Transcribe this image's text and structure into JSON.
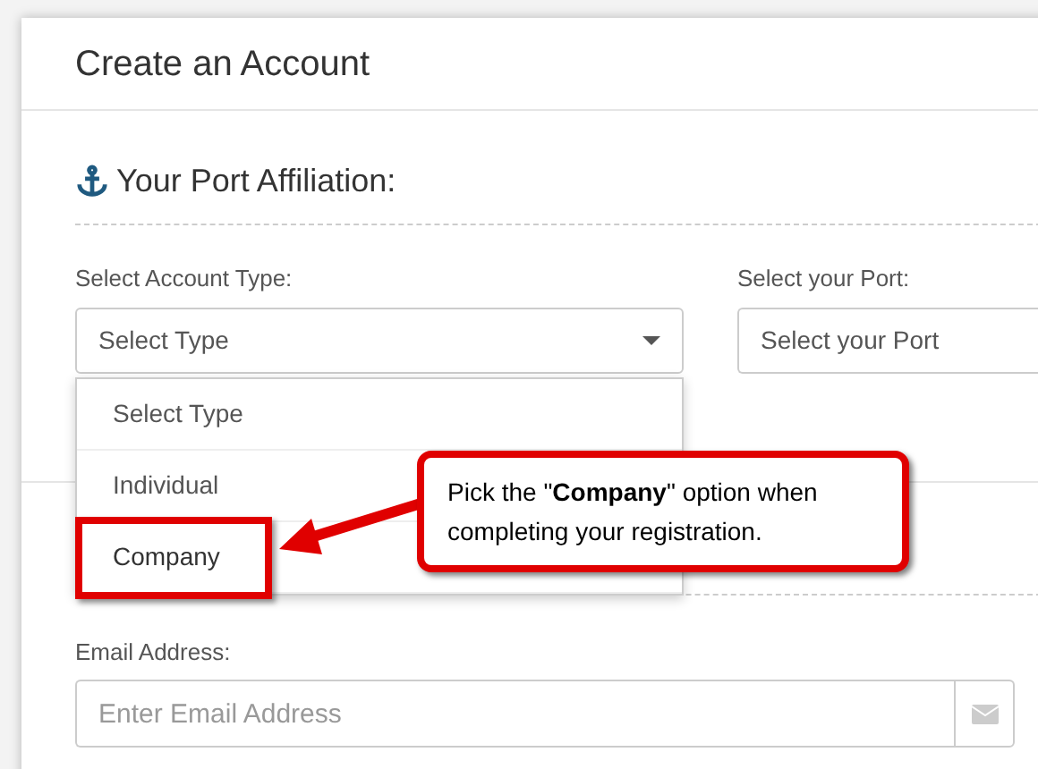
{
  "card": {
    "title": "Create an Account"
  },
  "section": {
    "title": "Your Port Affiliation:"
  },
  "account_type": {
    "label": "Select Account Type:",
    "value": "Select Type",
    "options": [
      {
        "label": "Select Type",
        "highlighted": false
      },
      {
        "label": "Individual",
        "highlighted": false
      },
      {
        "label": "Company",
        "highlighted": true
      }
    ]
  },
  "port": {
    "label": "Select your Port:",
    "value": "Select your Port"
  },
  "email": {
    "label": "Email Address:",
    "placeholder": "Enter Email Address"
  },
  "callout": {
    "text": "Pick the \"**Company**\" option when completing your registration."
  }
}
